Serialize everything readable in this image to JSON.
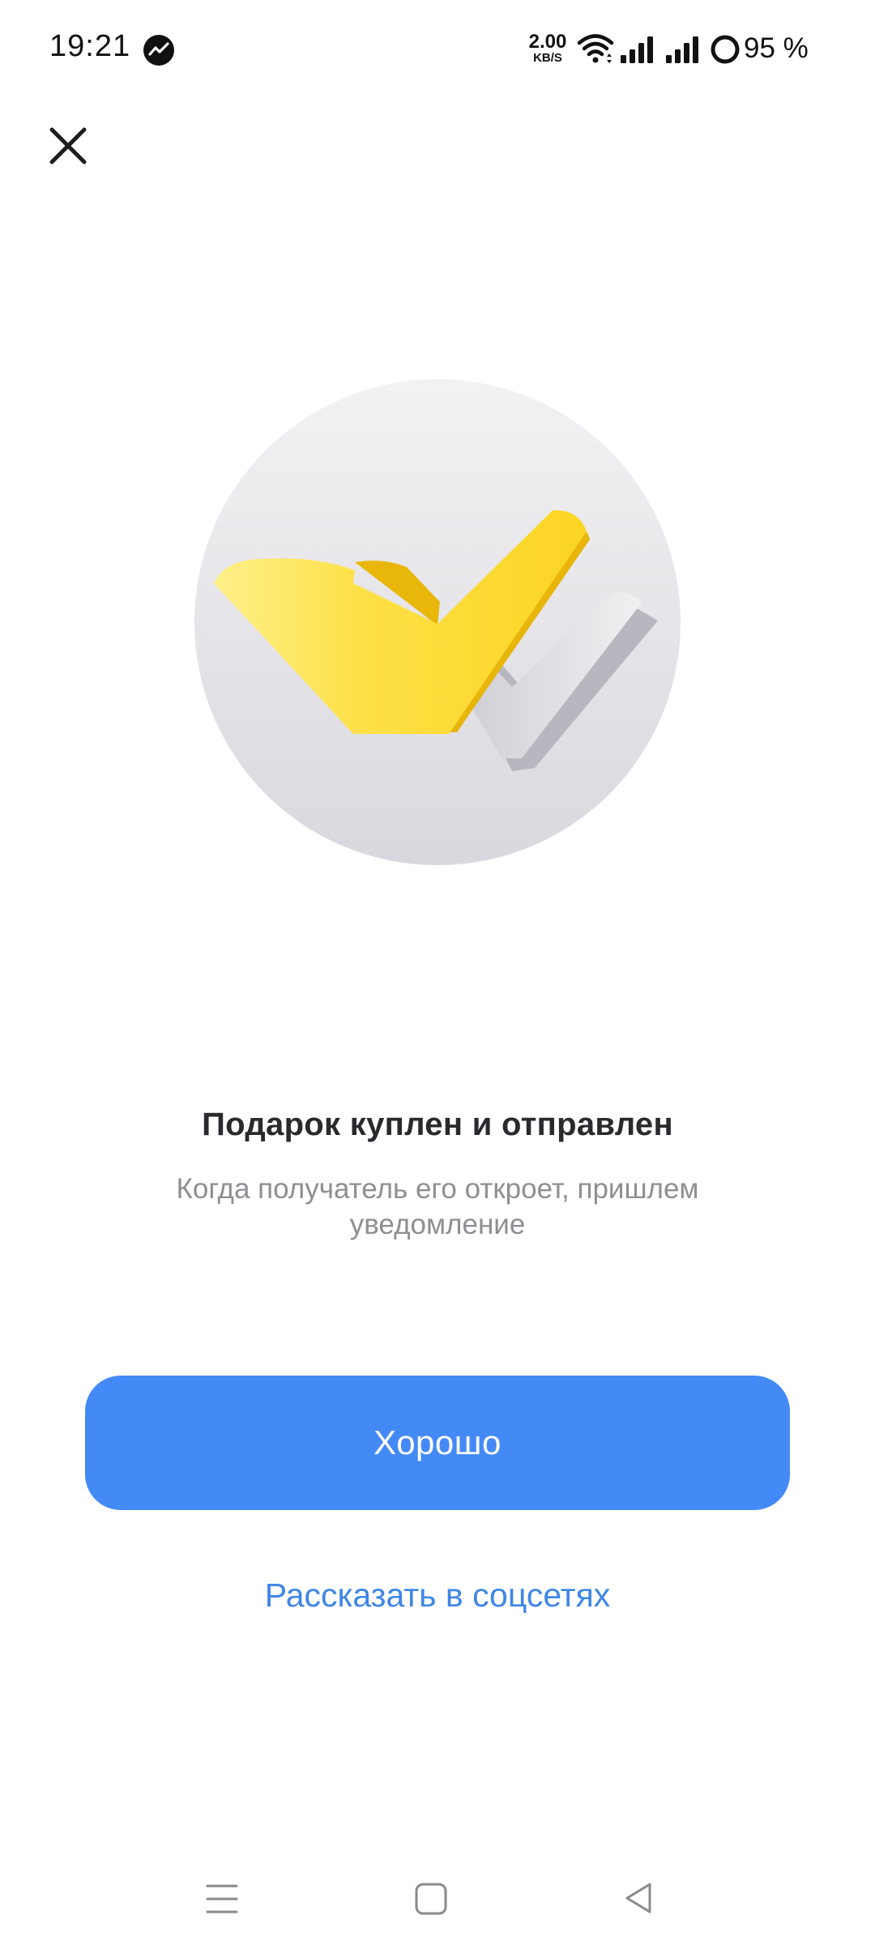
{
  "status_bar": {
    "time": "19:21",
    "net_speed_value": "2.00",
    "net_speed_unit": "KB/S",
    "battery_text": "95 %",
    "icons": [
      "messenger-icon",
      "wifi-icon",
      "signal-icon",
      "signal-icon",
      "battery-ring-icon"
    ]
  },
  "header": {
    "close_icon": "close-icon"
  },
  "hero": {
    "icon": "double-checkmark-icon"
  },
  "message": {
    "title": "Подарок куплен и отправлен",
    "subtitle": "Когда получатель его откроет, пришлем уведомление"
  },
  "actions": {
    "primary_label": "Хорошо",
    "secondary_label": "Рассказать в соцсетях"
  },
  "navigation": {
    "icons": [
      "menu-icon",
      "home-icon",
      "back-icon"
    ]
  },
  "colors": {
    "primary_button": "#448af6",
    "link": "#3f86e6",
    "title": "#2a2a2e",
    "subtitle": "#8e8e93",
    "check_yellow": "#fcd52b",
    "check_gray": "#d5d5da"
  }
}
